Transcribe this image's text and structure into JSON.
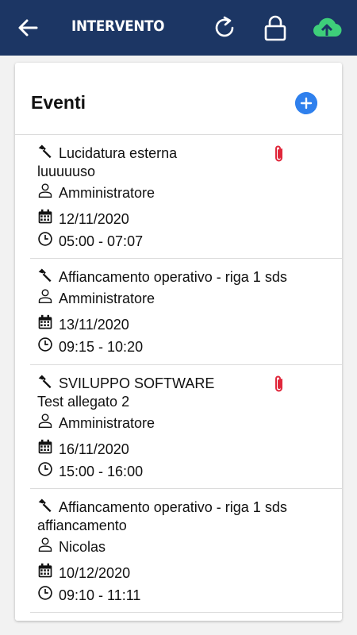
{
  "header": {
    "title": "INTERVENTO",
    "bg_color": "#1c3664",
    "icons": [
      "arrow-left-icon",
      "refresh-icon",
      "lock-icon",
      "cloud-upload-icon"
    ],
    "cloud_color": "#3ecf7a"
  },
  "card": {
    "title": "Eventi",
    "add_button_color": "#2f80ed"
  },
  "events": [
    {
      "title": "Lucidatura esterna",
      "subtitle": "luuuuuso",
      "user": "Amministratore",
      "date": "12/11/2020",
      "time": "05:00 - 07:07",
      "attachment": true
    },
    {
      "title": "Affiancamento operativo - riga 1 sds",
      "subtitle": "",
      "user": "Amministratore",
      "date": "13/11/2020",
      "time": "09:15 - 10:20",
      "attachment": false
    },
    {
      "title": "SVILUPPO SOFTWARE",
      "subtitle": "Test allegato 2",
      "user": "Amministratore",
      "date": "16/11/2020",
      "time": "15:00 - 16:00",
      "attachment": true
    },
    {
      "title": "Affiancamento operativo - riga 1 sds",
      "subtitle": "affiancamento",
      "user": "Nicolas",
      "date": "10/12/2020",
      "time": "09:10 - 11:11",
      "attachment": false
    }
  ],
  "attachment_color": "#e0273b"
}
